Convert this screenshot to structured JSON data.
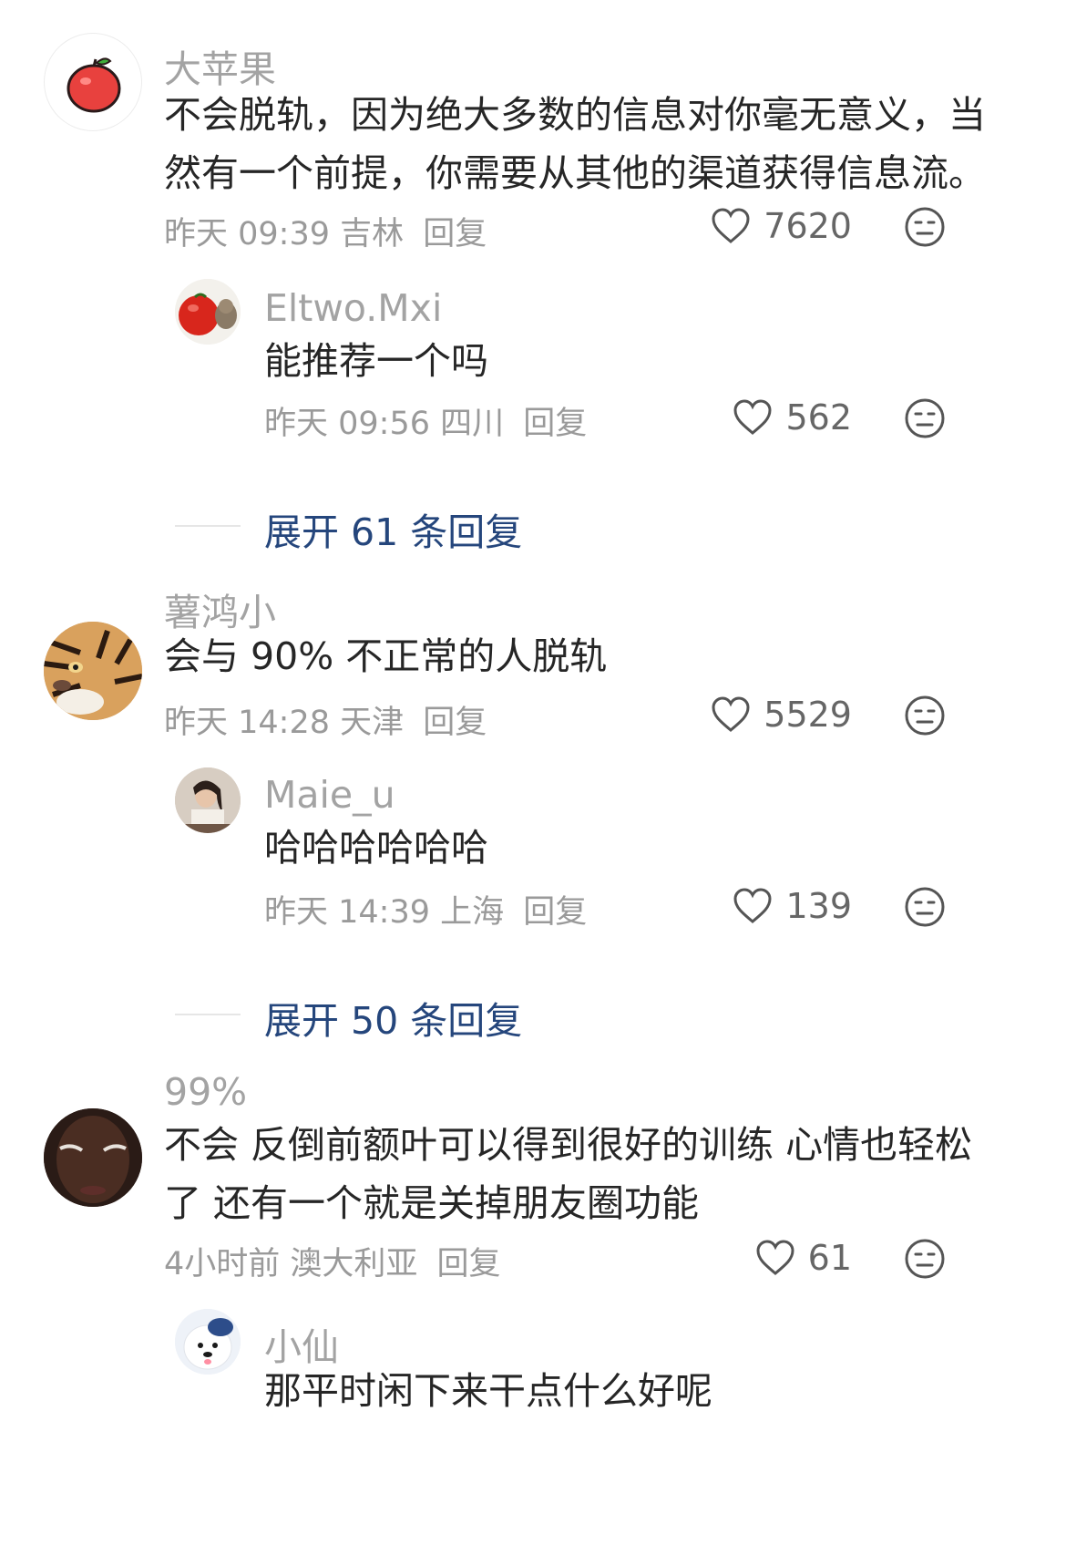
{
  "comments": [
    {
      "name": "大苹果",
      "avatar_icon": "apple-icon",
      "text_lines": [
        "不会脱轨，因为绝大多数的信息对你毫无意义，当",
        "然有一个前提，你需要从其他的渠道获得信息流。"
      ],
      "meta": "昨天 09:39 吉林",
      "reply_label": "回复",
      "likes": "7620",
      "reply": {
        "name": "Eltwo.Mxi",
        "avatar_icon": "tomato-hamster-avatar",
        "text": "能推荐一个吗",
        "meta": "昨天 09:56 四川",
        "reply_label": "回复",
        "likes": "562"
      },
      "expand": "展开 61 条回复"
    },
    {
      "name": "薯鸿小",
      "avatar_icon": "tiger-avatar",
      "text_lines": [
        "会与 90% 不正常的人脱轨"
      ],
      "meta": "昨天 14:28 天津",
      "reply_label": "回复",
      "likes": "5529",
      "reply": {
        "name": "Maie_u",
        "avatar_icon": "girl-photo-avatar",
        "text": "哈哈哈哈哈哈",
        "meta": "昨天 14:39 上海",
        "reply_label": "回复",
        "likes": "139"
      },
      "expand": "展开 50 条回复"
    },
    {
      "name": "99%",
      "avatar_icon": "dark-face-avatar",
      "text_lines": [
        "不会 反倒前额叶可以得到很好的训练 心情也轻松",
        "了 还有一个就是关掉朋友圈功能"
      ],
      "meta": "4小时前 澳大利亚",
      "reply_label": "回复",
      "likes": "61",
      "reply": {
        "name": "小仙",
        "avatar_icon": "puppy-avatar",
        "text": "那平时闲下来干点什么好呢"
      }
    }
  ],
  "colors": {
    "name": "#a3a3a3",
    "text": "#262626",
    "meta": "#9a9a9a",
    "expand": "#25467c"
  }
}
